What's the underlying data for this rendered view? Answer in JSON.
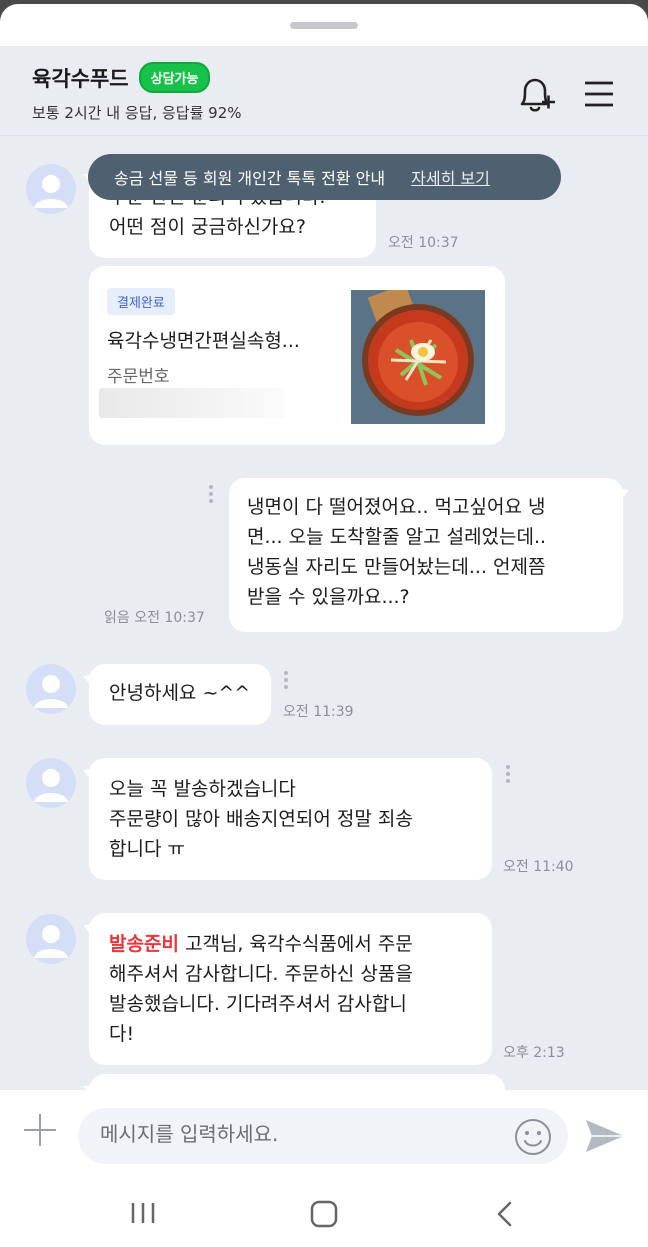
{
  "header": {
    "shop_name": "육각수푸드",
    "status_badge": "상담가능",
    "subtitle": "보통 2시간 내 응답, 응답률 92%"
  },
  "notice": {
    "text": "송금 선물 등 회원 개인간 톡톡 전환 안내",
    "link": "자세히 보기"
  },
  "messages": {
    "m1": {
      "partial_text": "주문 관련 문의 주셨습니다.",
      "text": "어떤 점이 궁금하신가요?",
      "time": "오전 10:37"
    },
    "order": {
      "tag": "결제완료",
      "product": "육각수냉면간편실속형...",
      "order_label": "주문번호"
    },
    "m2": {
      "line1": "냉면이 다 떨어졌어요.. 먹고싶어요 냉",
      "line2": "면... 오늘 도착할줄 알고 설레었는데..",
      "line3": "냉동실 자리도 만들어놨는데... 언제쯤",
      "line4": "받을 수 있을까요...?",
      "meta": "읽음 오전 10:37"
    },
    "m3": {
      "text": "안녕하세요 ~^^",
      "time": "오전 11:39"
    },
    "m4": {
      "line1": "오늘 꼭 발송하겠습니다",
      "line2": "주문량이 많아 배송지연되어 정말 죄송",
      "line3": "합니다 ㅠ",
      "time": "오전 11:40"
    },
    "m5": {
      "highlight": "발송준비",
      "line1_rest": " 고객님, 육각수식품에서 주문",
      "line2": "해주셔서 감사합니다. 주문하신 상품을",
      "line3": "발송했습니다. 기다려주셔서 감사합니",
      "line4": "다!",
      "time": "오후 2:13"
    }
  },
  "input": {
    "placeholder": "메시지를 입력하세요."
  },
  "colors": {
    "accent_green": "#18c24a",
    "highlight_red": "#e8363c",
    "chat_bg": "#e9ecf1"
  }
}
